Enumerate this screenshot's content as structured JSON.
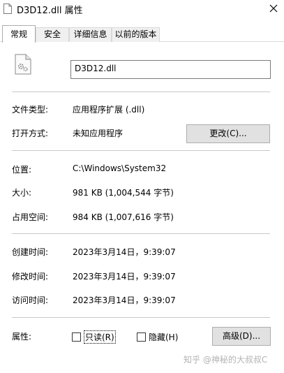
{
  "window": {
    "title": "D3D12.dll 属性"
  },
  "tabs": [
    {
      "label": "常规",
      "active": true
    },
    {
      "label": "安全",
      "active": false
    },
    {
      "label": "详细信息",
      "active": false
    },
    {
      "label": "以前的版本",
      "active": false
    }
  ],
  "file": {
    "name": "D3D12.dll",
    "icon": "dll-file-gear-icon"
  },
  "info": {
    "type_label": "文件类型:",
    "type_value": "应用程序扩展 (.dll)",
    "open_label": "打开方式:",
    "open_value": "未知应用程序",
    "change_button": "更改(C)...",
    "location_label": "位置:",
    "location_value": "C:\\Windows\\System32",
    "size_label": "大小:",
    "size_value": "981 KB (1,004,544 字节)",
    "disk_label": "占用空间:",
    "disk_value": "984 KB (1,007,616 字节)",
    "created_label": "创建时间:",
    "created_value": "2023年3月14日，9:39:07",
    "modified_label": "修改时间:",
    "modified_value": "2023年3月14日，9:39:07",
    "accessed_label": "访问时间:",
    "accessed_value": "2023年3月14日，9:39:07"
  },
  "attributes": {
    "label": "属性:",
    "readonly_label": "只读(R)",
    "readonly_checked": false,
    "hidden_label": "隐藏(H)",
    "hidden_checked": false,
    "advanced_button": "高级(D)..."
  },
  "watermark": "知乎 @神秘的大叔叔C"
}
